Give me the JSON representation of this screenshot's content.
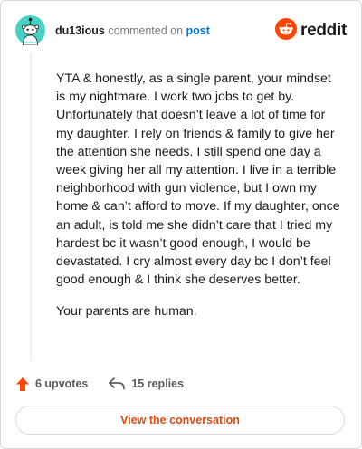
{
  "header": {
    "username": "du13ious",
    "action_text": "commented on",
    "post_link": "post",
    "brand_name": "reddit",
    "avatar_icon": "snoo-avatar-icon",
    "logo_icon": "reddit-snoo-logo-icon",
    "colors": {
      "avatar_bg": "#46d3c5",
      "brand": "#ff4500",
      "post_link": "#0079d3"
    }
  },
  "comment": {
    "paragraphs": [
      "YTA & honestly, as a single parent, your mindset is my nightmare. I work two jobs to get by. Unfortunately that doesn’t leave a lot of time for my daughter. I rely on friends & family to give her the attention she needs. I still spend one day a week giving her all my attention. I live in a terrible neighborhood with gun violence, but I own my home & can’t afford to move. If my daughter, once an adult, is told me she didn’t care that I tried my hardest bc it wasn’t good enough, I would be devastated. I cry almost every day bc I don’t feel good enough & I think she deserves better.",
      "Your parents are human."
    ]
  },
  "footer": {
    "upvotes_label": "6 upvotes",
    "replies_label": "15 replies",
    "upvote_icon": "upvote-arrow-icon",
    "reply_icon": "reply-arrow-icon",
    "upvote_color": "#ff4500"
  },
  "cta": {
    "label": "View the conversation",
    "color": "#dd4c14"
  }
}
